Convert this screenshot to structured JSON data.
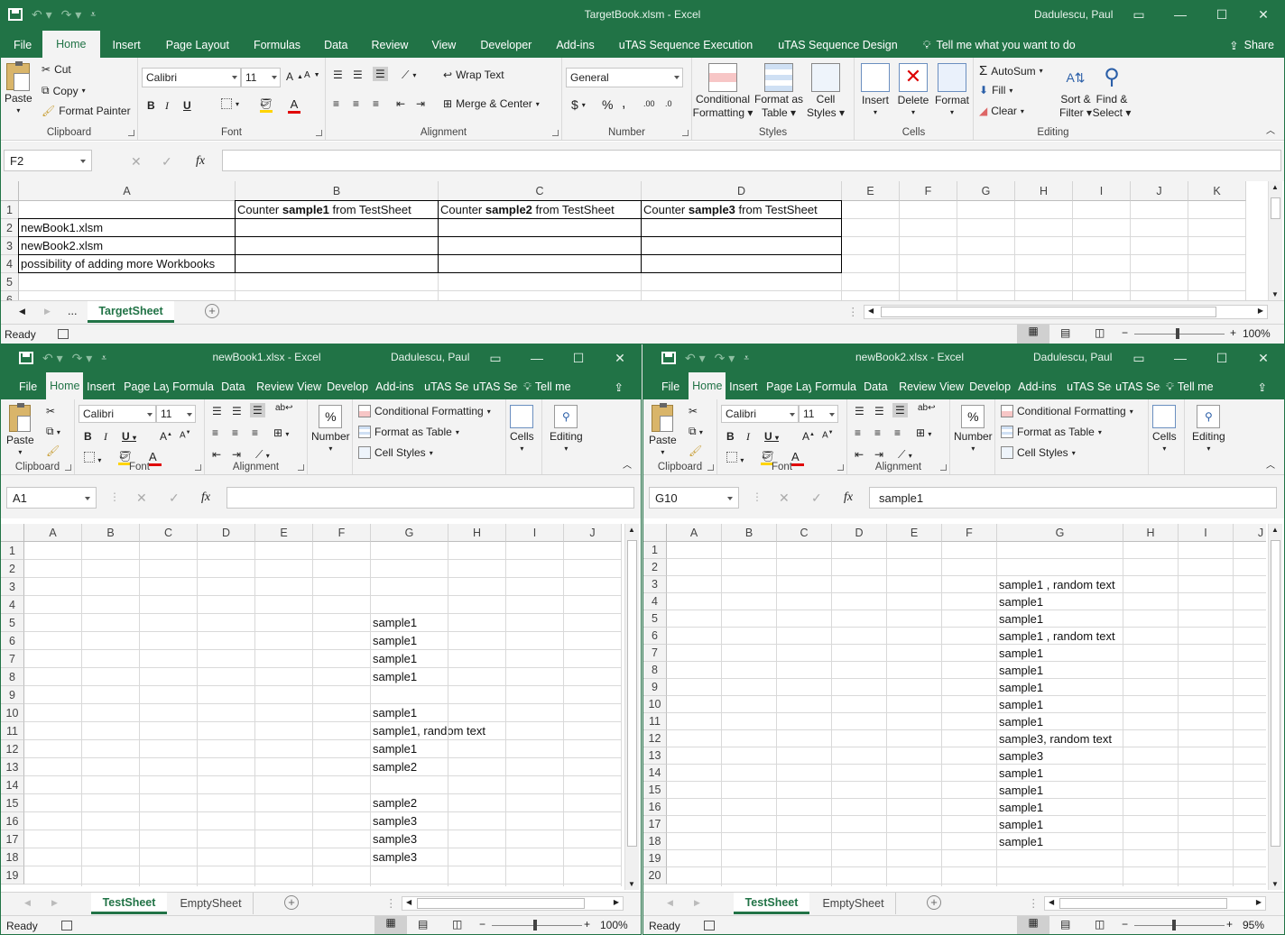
{
  "top": {
    "title": "TargetBook.xlsm  -  Excel",
    "user": "Dadulescu, Paul",
    "tabs": [
      "File",
      "Home",
      "Insert",
      "Page Layout",
      "Formulas",
      "Data",
      "Review",
      "View",
      "Developer",
      "Add-ins",
      "uTAS Sequence Execution",
      "uTAS Sequence Design"
    ],
    "tell_me": "Tell me what you want to do",
    "share": "Share",
    "clipboard": {
      "paste": "Paste",
      "cut": "Cut",
      "copy": "Copy",
      "format_painter": "Format Painter",
      "label": "Clipboard"
    },
    "font": {
      "name": "Calibri",
      "size": "11",
      "label": "Font",
      "bold": "B",
      "italic": "I",
      "underline": "U"
    },
    "alignment": {
      "wrap": "Wrap Text",
      "merge": "Merge & Center",
      "label": "Alignment"
    },
    "number": {
      "format": "General",
      "label": "Number",
      "currency": "$",
      "percent": "%",
      "comma": ","
    },
    "styles": {
      "conditional": "Conditional",
      "conditional2": "Formatting",
      "format_table": "Format as",
      "format_table2": "Table",
      "cell_styles": "Cell",
      "cell_styles2": "Styles",
      "label": "Styles"
    },
    "cells": {
      "insert": "Insert",
      "delete": "Delete",
      "format": "Format",
      "label": "Cells"
    },
    "editing": {
      "autosum": "AutoSum",
      "fill": "Fill",
      "clear": "Clear",
      "sort": "Sort &",
      "sort2": "Filter",
      "find": "Find &",
      "find2": "Select",
      "label": "Editing"
    },
    "namebox": "F2",
    "formula": "",
    "columns": [
      "A",
      "B",
      "C",
      "D",
      "E",
      "F",
      "G",
      "H",
      "I",
      "J",
      "K"
    ],
    "rows": [
      "1",
      "2",
      "3",
      "4",
      "5",
      "6"
    ],
    "cells_data": {
      "B1_pre": "Counter ",
      "B1_bold": "sample1",
      "B1_post": " from TestSheet",
      "C1_pre": "Counter ",
      "C1_bold": "sample2",
      "C1_post": " from TestSheet",
      "D1_pre": "Counter ",
      "D1_bold": "sample3",
      "D1_post": " from TestSheet",
      "A2": "newBook1.xlsm",
      "A3": "newBook2.xlsm",
      "A4": "possibility of adding more Workbooks"
    },
    "sheet_ellipsis": "...",
    "sheet_tab": "TargetSheet",
    "status": "Ready",
    "zoom": "100%"
  },
  "left": {
    "title": "newBook1.xlsx  -  Excel",
    "user": "Dadulescu, Paul",
    "tabs": [
      "File",
      "Home",
      "Insert",
      "Page Lay",
      "Formula",
      "Data",
      "Review",
      "View",
      "Develop",
      "Add-ins",
      "uTAS Sec",
      "uTAS Sec"
    ],
    "tell_me": "Tell me",
    "paste": "Paste",
    "clipboard": "Clipboard",
    "font_name": "Calibri",
    "font_size": "11",
    "font": "Font",
    "alignment": "Alignment",
    "number": "Number",
    "percent": "%",
    "cond": "Conditional Formatting",
    "fmt_table": "Format as Table",
    "cell_styles": "Cell Styles",
    "styles": "Styles",
    "cells": "Cells",
    "editing": "Editing",
    "namebox": "A1",
    "formula": "",
    "columns": [
      "A",
      "B",
      "C",
      "D",
      "E",
      "F",
      "G",
      "H",
      "I",
      "J"
    ],
    "rows": [
      "1",
      "2",
      "3",
      "4",
      "5",
      "6",
      "7",
      "8",
      "9",
      "10",
      "11",
      "12",
      "13",
      "14",
      "15",
      "16",
      "17",
      "18",
      "19"
    ],
    "g_values": [
      "",
      "",
      "",
      "",
      "sample1",
      "sample1",
      "sample1",
      "sample1",
      "",
      "sample1",
      "sample1, random text",
      "sample1",
      "sample2",
      "",
      "sample2",
      "sample3",
      "sample3",
      "sample3",
      ""
    ],
    "sheet_tabs": [
      "TestSheet",
      "EmptySheet"
    ],
    "status": "Ready",
    "zoom": "100%"
  },
  "right": {
    "title": "newBook2.xlsx  -  Excel",
    "user": "Dadulescu, Paul",
    "tabs": [
      "File",
      "Home",
      "Insert",
      "Page Lay",
      "Formula",
      "Data",
      "Review",
      "View",
      "Develop",
      "Add-ins",
      "uTAS Sec",
      "uTAS Sec"
    ],
    "tell_me": "Tell me",
    "paste": "Paste",
    "clipboard": "Clipboard",
    "font_name": "Calibri",
    "font_size": "11",
    "font": "Font",
    "alignment": "Alignment",
    "number": "Number",
    "percent": "%",
    "cond": "Conditional Formatting",
    "fmt_table": "Format as Table",
    "cell_styles": "Cell Styles",
    "styles": "Styles",
    "cells": "Cells",
    "editing": "Editing",
    "namebox": "G10",
    "formula": "sample1",
    "columns": [
      "A",
      "B",
      "C",
      "D",
      "E",
      "F",
      "G",
      "H",
      "I",
      "J"
    ],
    "rows": [
      "1",
      "2",
      "3",
      "4",
      "5",
      "6",
      "7",
      "8",
      "9",
      "10",
      "11",
      "12",
      "13",
      "14",
      "15",
      "16",
      "17",
      "18",
      "19",
      "20"
    ],
    "g_values": [
      "",
      "",
      "sample1 , random text",
      "sample1",
      "sample1",
      "sample1 , random text",
      "sample1",
      "sample1",
      "sample1",
      "sample1",
      "sample1",
      "sample3, random text",
      "sample3",
      "sample1",
      "sample1",
      "sample1",
      "sample1",
      "sample1",
      "",
      ""
    ],
    "sheet_tabs": [
      "TestSheet",
      "EmptySheet"
    ],
    "status": "Ready",
    "zoom": "95%"
  },
  "icons": [
    "save-icon",
    "undo-icon",
    "redo-icon",
    "lightbulb-icon",
    "share-icon",
    "cut-icon",
    "copy-icon",
    "format-painter-icon",
    "paste-icon",
    "fx-icon",
    "add-sheet-icon",
    "normal-view-icon",
    "page-layout-icon",
    "page-break-icon"
  ],
  "colors": {
    "excel_green": "#217346",
    "ribbon_bg": "#f3f3f3",
    "fill_yellow": "#ffd400",
    "font_red": "#e00000"
  }
}
